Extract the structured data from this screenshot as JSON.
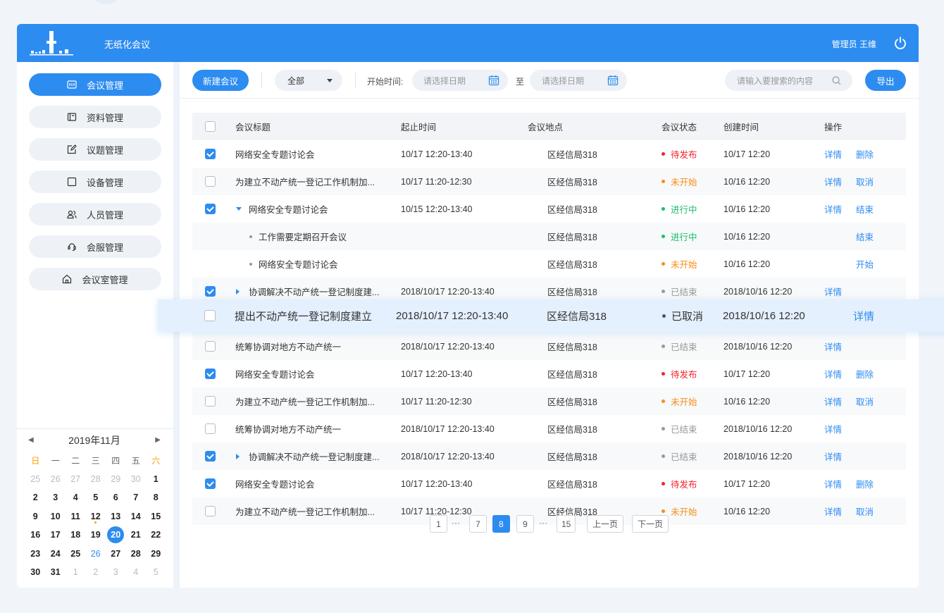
{
  "app": {
    "title": "无纸化会议",
    "user": "管理员 王维"
  },
  "sidebar": {
    "items": [
      {
        "label": "会议管理",
        "icon": "meeting-icon",
        "active": true
      },
      {
        "label": "资料管理",
        "icon": "folder-icon",
        "active": false
      },
      {
        "label": "议题管理",
        "icon": "edit-icon",
        "active": false
      },
      {
        "label": "设备管理",
        "icon": "device-icon",
        "active": false
      },
      {
        "label": "人员管理",
        "icon": "people-icon",
        "active": false
      },
      {
        "label": "会服管理",
        "icon": "service-icon",
        "active": false
      },
      {
        "label": "会议室管理",
        "icon": "home-icon",
        "active": false
      }
    ]
  },
  "calendar": {
    "month_label": "2019年11月",
    "weekdays": [
      "日",
      "一",
      "二",
      "三",
      "四",
      "五",
      "六"
    ],
    "days": [
      [
        "25",
        "26",
        "27",
        "28",
        "29",
        "30",
        "1"
      ],
      [
        "2",
        "3",
        "4",
        "5",
        "6",
        "7",
        "8"
      ],
      [
        "9",
        "10",
        "11",
        "12",
        "13",
        "14",
        "15"
      ],
      [
        "16",
        "17",
        "18",
        "19",
        "20",
        "21",
        "22"
      ],
      [
        "23",
        "24",
        "25",
        "26",
        "27",
        "28",
        "29"
      ],
      [
        "30",
        "31",
        "1",
        "2",
        "3",
        "4",
        "5"
      ]
    ],
    "today": "20"
  },
  "toolbar": {
    "new_label": "新建会议",
    "filter_value": "全部",
    "start_label": "开始时间:",
    "date_placeholder_1": "请选择日期",
    "to_label": "至",
    "date_placeholder_2": "请选择日期",
    "search_placeholder": "请输入要搜索的内容",
    "export_label": "导出"
  },
  "table": {
    "headers": [
      "会议标题",
      "起止时间",
      "会议地点",
      "会议状态",
      "创建时间",
      "操作"
    ],
    "rows": [
      {
        "checked": true,
        "indent": "none",
        "title": "网络安全专题讨论会",
        "time": "10/17  12:20-13:40",
        "place": "区经信局318",
        "status": "待发布",
        "status_color": "#f5222d",
        "created": "10/17  12:20",
        "op1": "详情",
        "op2": "删除"
      },
      {
        "checked": false,
        "indent": "none",
        "title": "为建立不动产统一登记工作机制加...",
        "time": "10/17  11:20-12:30",
        "place": "区经信局318",
        "status": "未开始",
        "status_color": "#fa8c16",
        "created": "10/16  12:20",
        "op1": "详情",
        "op2": "取消"
      },
      {
        "checked": true,
        "indent": "expanded",
        "title": "网络安全专题讨论会",
        "time": "10/15  12:20-13:40",
        "place": "区经信局318",
        "status": "进行中",
        "status_color": "#19be6b",
        "created": "10/16  12:20",
        "op1": "详情",
        "op2": "结束"
      },
      {
        "checked": null,
        "indent": "child",
        "title": "工作需要定期召开会议",
        "time": "",
        "place": "区经信局318",
        "status": "进行中",
        "status_color": "#19be6b",
        "created": "10/16  12:20",
        "op1": "",
        "op2": "结束"
      },
      {
        "checked": null,
        "indent": "child",
        "title": "网络安全专题讨论会",
        "time": "",
        "place": "区经信局318",
        "status": "未开始",
        "status_color": "#fa8c16",
        "created": "10/16  12:20",
        "op1": "",
        "op2": "开始"
      },
      {
        "checked": true,
        "indent": "collapsed",
        "title": "协调解决不动产统一登记制度建...",
        "time": "2018/10/17  12:20-13:40",
        "place": "区经信局318",
        "status": "已结束",
        "status_color": "#999999",
        "created": "2018/10/16  12:20",
        "op1": "详情",
        "op2": ""
      },
      {
        "checked": false,
        "indent": "none",
        "title": "",
        "time": "",
        "place": "",
        "status": "",
        "status_color": "#999999",
        "created": "",
        "op1": "",
        "op2": ""
      },
      {
        "checked": false,
        "indent": "none",
        "title": "统筹协调对地方不动产统一",
        "time": "2018/10/17  12:20-13:40",
        "place": "区经信局318",
        "status": "已结束",
        "status_color": "#999999",
        "created": "2018/10/16  12:20",
        "op1": "详情",
        "op2": ""
      },
      {
        "checked": true,
        "indent": "none",
        "title": "网络安全专题讨论会",
        "time": "10/17  12:20-13:40",
        "place": "区经信局318",
        "status": "待发布",
        "status_color": "#f5222d",
        "created": "10/17  12:20",
        "op1": "详情",
        "op2": "删除"
      },
      {
        "checked": false,
        "indent": "none",
        "title": "为建立不动产统一登记工作机制加...",
        "time": "10/17  11:20-12:30",
        "place": "区经信局318",
        "status": "未开始",
        "status_color": "#fa8c16",
        "created": "10/16  12:20",
        "op1": "详情",
        "op2": "取消"
      },
      {
        "checked": false,
        "indent": "none",
        "title": "统筹协调对地方不动产统一",
        "time": "2018/10/17  12:20-13:40",
        "place": "区经信局318",
        "status": "已结束",
        "status_color": "#999999",
        "created": "2018/10/16  12:20",
        "op1": "详情",
        "op2": ""
      },
      {
        "checked": true,
        "indent": "collapsed",
        "title": "协调解决不动产统一登记制度建...",
        "time": "2018/10/17  12:20-13:40",
        "place": "区经信局318",
        "status": "已结束",
        "status_color": "#999999",
        "created": "2018/10/16  12:20",
        "op1": "详情",
        "op2": ""
      },
      {
        "checked": true,
        "indent": "none",
        "title": "网络安全专题讨论会",
        "time": "10/17  12:20-13:40",
        "place": "区经信局318",
        "status": "待发布",
        "status_color": "#f5222d",
        "created": "10/17  12:20",
        "op1": "详情",
        "op2": "删除"
      },
      {
        "checked": false,
        "indent": "none",
        "title": "为建立不动产统一登记工作机制加...",
        "time": "10/17  11:20-12:30",
        "place": "区经信局318",
        "status": "未开始",
        "status_color": "#fa8c16",
        "created": "10/16  12:20",
        "op1": "详情",
        "op2": "取消"
      }
    ],
    "highlight": {
      "checked": false,
      "title": "提出不动产统一登记制度建立",
      "time": "2018/10/17  12:20-13:40",
      "place": "区经信局318",
      "status": "已取消",
      "created": "2018/10/16  12:20",
      "op1": "详情"
    }
  },
  "pagination": {
    "pages": [
      "1",
      "7",
      "8",
      "9",
      "15"
    ],
    "current": "8",
    "ellipsis": "···",
    "prev_label": "上一页",
    "next_label": "下一页"
  },
  "colors": {
    "accent": "#2d8cf0",
    "danger": "#f5222d",
    "warning": "#fa8c16",
    "success": "#19be6b",
    "muted": "#999999"
  }
}
